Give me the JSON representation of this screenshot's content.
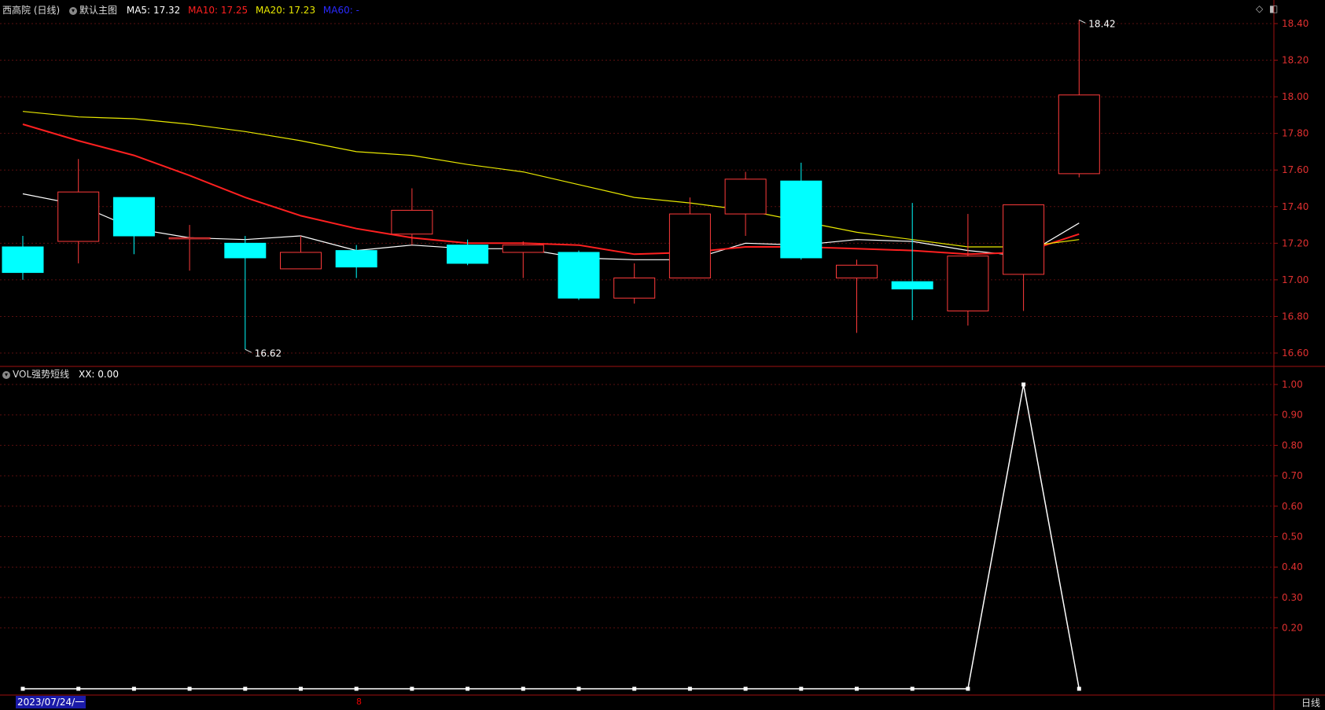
{
  "header": {
    "stock_title": "西高院 (日线)",
    "main_chart_label": "默认主图",
    "ma5": {
      "label": "MA5:",
      "value": "17.32",
      "color": "#ffffff"
    },
    "ma10": {
      "label": "MA10:",
      "value": "17.25",
      "color": "#ff2020"
    },
    "ma20": {
      "label": "MA20:",
      "value": "17.23",
      "color": "#e8e800"
    },
    "ma60": {
      "label": "MA60:",
      "value": "-",
      "color": "#2a2aff"
    }
  },
  "sub_header": {
    "indicator_label": "VOL强势短线",
    "xx_label": "XX:",
    "xx_value": "0.00"
  },
  "footer": {
    "date": "2023/07/24/一",
    "month_marker": "8",
    "period": "日线"
  },
  "icons": {
    "toolbar": [
      "diamond-icon",
      "panel-toggle-icon"
    ]
  },
  "chart_data": [
    {
      "type": "candlestick",
      "title": "西高院 (日线)",
      "ylim": [
        16.5,
        18.5
      ],
      "yticks": [
        "18.40",
        "18.20",
        "18.00",
        "17.80",
        "17.60",
        "17.40",
        "17.20",
        "17.00",
        "16.80",
        "16.60"
      ],
      "grid": true,
      "up_color": "#ff3b3b",
      "down_color": "#00ffff",
      "candles": [
        {
          "o": 17.18,
          "h": 17.24,
          "l": 17.0,
          "c": 17.04
        },
        {
          "o": 17.21,
          "h": 17.66,
          "l": 17.09,
          "c": 17.48
        },
        {
          "o": 17.45,
          "h": 17.45,
          "l": 17.14,
          "c": 17.24
        },
        {
          "o": 17.23,
          "h": 17.3,
          "l": 17.05,
          "c": 17.23
        },
        {
          "o": 17.2,
          "h": 17.24,
          "l": 16.62,
          "c": 17.12
        },
        {
          "o": 17.06,
          "h": 17.24,
          "l": 17.06,
          "c": 17.15
        },
        {
          "o": 17.16,
          "h": 17.19,
          "l": 17.01,
          "c": 17.07
        },
        {
          "o": 17.25,
          "h": 17.5,
          "l": 17.19,
          "c": 17.38
        },
        {
          "o": 17.19,
          "h": 17.22,
          "l": 17.08,
          "c": 17.09
        },
        {
          "o": 17.15,
          "h": 17.21,
          "l": 17.01,
          "c": 17.19
        },
        {
          "o": 17.15,
          "h": 17.16,
          "l": 16.89,
          "c": 16.9
        },
        {
          "o": 16.9,
          "h": 17.09,
          "l": 16.87,
          "c": 17.01
        },
        {
          "o": 17.01,
          "h": 17.45,
          "l": 17.01,
          "c": 17.36
        },
        {
          "o": 17.36,
          "h": 17.59,
          "l": 17.24,
          "c": 17.55
        },
        {
          "o": 17.54,
          "h": 17.64,
          "l": 17.11,
          "c": 17.12
        },
        {
          "o": 17.01,
          "h": 17.11,
          "l": 16.71,
          "c": 17.08
        },
        {
          "o": 16.99,
          "h": 17.42,
          "l": 16.78,
          "c": 16.95
        },
        {
          "o": 16.83,
          "h": 17.36,
          "l": 16.75,
          "c": 17.13
        },
        {
          "o": 17.03,
          "h": 17.41,
          "l": 16.83,
          "c": 17.41
        },
        {
          "o": 17.58,
          "h": 18.42,
          "l": 17.56,
          "c": 18.01
        }
      ],
      "series": [
        {
          "name": "MA5",
          "values": [
            17.47,
            17.41,
            17.28,
            17.23,
            17.22,
            17.24,
            17.16,
            17.19,
            17.17,
            17.17,
            17.12,
            17.11,
            17.11,
            17.2,
            17.19,
            17.22,
            17.21,
            17.16,
            17.13,
            17.31
          ]
        },
        {
          "name": "MA10",
          "values": [
            17.85,
            17.76,
            17.68,
            17.57,
            17.45,
            17.35,
            17.28,
            17.23,
            17.2,
            17.2,
            17.19,
            17.14,
            17.15,
            17.18,
            17.18,
            17.17,
            17.16,
            17.14,
            17.15,
            17.25
          ]
        },
        {
          "name": "MA20",
          "values": [
            17.92,
            17.89,
            17.88,
            17.85,
            17.81,
            17.76,
            17.7,
            17.68,
            17.63,
            17.59,
            17.52,
            17.45,
            17.42,
            17.38,
            17.32,
            17.26,
            17.22,
            17.18,
            17.18,
            17.22
          ]
        }
      ],
      "annotations": [
        {
          "text": "18.42",
          "x_index": 19,
          "value": 18.42
        },
        {
          "text": "16.62",
          "x_index": 4,
          "value": 16.62
        }
      ]
    },
    {
      "type": "line",
      "title": "VOL强势短线",
      "ylim": [
        0,
        1.0
      ],
      "yticks": [
        "1.00",
        "0.90",
        "0.80",
        "0.70",
        "0.60",
        "0.50",
        "0.40",
        "0.30",
        "0.20"
      ],
      "grid": true,
      "series": [
        {
          "name": "XX",
          "values": [
            0,
            0,
            0,
            0,
            0,
            0,
            0,
            0,
            0,
            0,
            0,
            0,
            0,
            0,
            0,
            0,
            0,
            0,
            1,
            0
          ]
        }
      ]
    }
  ]
}
